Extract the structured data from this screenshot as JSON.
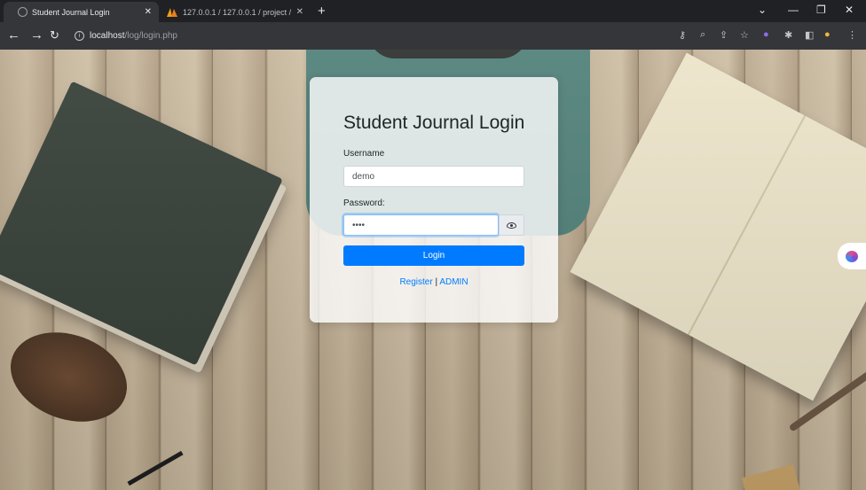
{
  "browser": {
    "tabs": [
      {
        "title": "Student Journal Login",
        "active": true
      },
      {
        "title": "127.0.0.1 / 127.0.0.1 / project / ",
        "active": false
      }
    ],
    "url_host": "localhost",
    "url_path": "/log/login.php"
  },
  "login": {
    "heading": "Student Journal Login",
    "username_label": "Username",
    "username_value": "demo",
    "password_label": "Password:",
    "password_value": "••••",
    "login_button": "Login",
    "register_link": "Register",
    "separator": "|",
    "admin_link": "ADMIN"
  },
  "colors": {
    "primary": "#007bff",
    "tab_active": "#35363a",
    "chrome_dark": "#202124"
  }
}
